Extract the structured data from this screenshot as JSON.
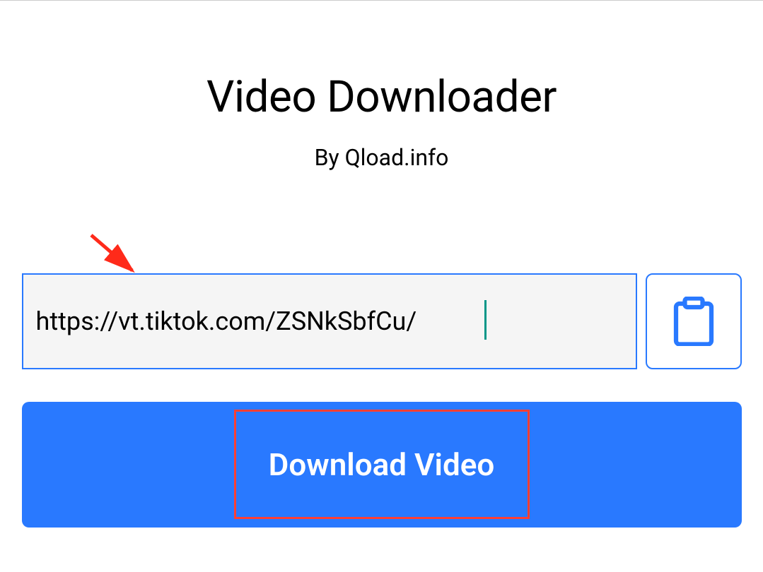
{
  "header": {
    "title": "Video Downloader",
    "subtitle": "By Qload.info"
  },
  "input": {
    "url_value": "https://vt.tiktok.com/ZSNkSbfCu/"
  },
  "actions": {
    "download_label": "Download Video"
  }
}
